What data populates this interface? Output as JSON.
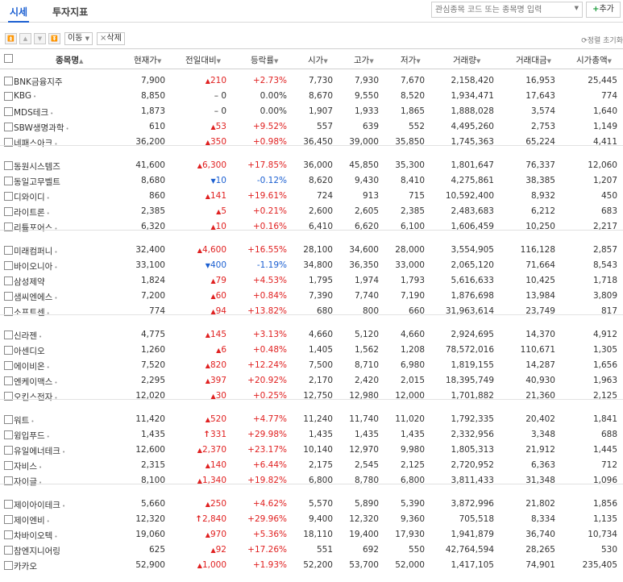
{
  "tabs": [
    {
      "label": "시세",
      "active": true
    },
    {
      "label": "투자지표",
      "active": false
    }
  ],
  "search": {
    "placeholder": "관심종목 코드 또는 종목명 입력",
    "dropdown_icon": "caret-down-icon"
  },
  "add_button": {
    "plus": "+",
    "label": "추가"
  },
  "toolbar": {
    "move_label": "이동",
    "delete_label": "삭제",
    "reset_label": "정렬 초기화"
  },
  "columns": [
    "종목명",
    "현재가",
    "전일대비",
    "등락률",
    "시가",
    "고가",
    "저가",
    "거래량",
    "거래대금",
    "시가총액"
  ],
  "colors": {
    "up": "#e02020",
    "down": "#1b5fd1",
    "accent": "#1b5fd1"
  },
  "groups": [
    [
      {
        "name": "BNK금융지주",
        "dot": false,
        "price": "7,900",
        "change": "210",
        "dir": "up",
        "rate": "+2.73%",
        "open": "7,730",
        "high": "7,930",
        "low": "7,670",
        "volume": "2,158,420",
        "amount": "16,953",
        "cap": "25,445"
      },
      {
        "name": "KBG",
        "dot": true,
        "price": "8,850",
        "change": "0",
        "dir": "flat",
        "rate": "0.00%",
        "open": "8,670",
        "high": "9,550",
        "low": "8,520",
        "volume": "1,934,471",
        "amount": "17,643",
        "cap": "774"
      },
      {
        "name": "MDS테크",
        "dot": true,
        "price": "1,873",
        "change": "0",
        "dir": "flat",
        "rate": "0.00%",
        "open": "1,907",
        "high": "1,933",
        "low": "1,865",
        "volume": "1,888,028",
        "amount": "3,574",
        "cap": "1,640"
      },
      {
        "name": "SBW생명과학",
        "dot": true,
        "price": "610",
        "change": "53",
        "dir": "up",
        "rate": "+9.52%",
        "open": "557",
        "high": "639",
        "low": "552",
        "volume": "4,495,260",
        "amount": "2,753",
        "cap": "1,149"
      },
      {
        "name": "네패스아크",
        "dot": true,
        "price": "36,200",
        "change": "350",
        "dir": "up",
        "rate": "+0.98%",
        "open": "36,450",
        "high": "39,000",
        "low": "35,850",
        "volume": "1,745,363",
        "amount": "65,224",
        "cap": "4,411"
      }
    ],
    [
      {
        "name": "동원시스템즈",
        "dot": false,
        "price": "41,600",
        "change": "6,300",
        "dir": "up",
        "rate": "+17.85%",
        "open": "36,000",
        "high": "45,850",
        "low": "35,300",
        "volume": "1,801,647",
        "amount": "76,337",
        "cap": "12,060"
      },
      {
        "name": "동일고무벨트",
        "dot": false,
        "price": "8,680",
        "change": "10",
        "dir": "down",
        "rate": "-0.12%",
        "open": "8,620",
        "high": "9,430",
        "low": "8,410",
        "volume": "4,275,861",
        "amount": "38,385",
        "cap": "1,207"
      },
      {
        "name": "디와이디",
        "dot": true,
        "price": "860",
        "change": "141",
        "dir": "up",
        "rate": "+19.61%",
        "open": "724",
        "high": "913",
        "low": "715",
        "volume": "10,592,400",
        "amount": "8,932",
        "cap": "450"
      },
      {
        "name": "라이트론",
        "dot": true,
        "price": "2,385",
        "change": "5",
        "dir": "up",
        "rate": "+0.21%",
        "open": "2,600",
        "high": "2,605",
        "low": "2,385",
        "volume": "2,483,683",
        "amount": "6,212",
        "cap": "683"
      },
      {
        "name": "리튬포어스",
        "dot": true,
        "price": "6,320",
        "change": "10",
        "dir": "up",
        "rate": "+0.16%",
        "open": "6,410",
        "high": "6,620",
        "low": "6,100",
        "volume": "1,606,459",
        "amount": "10,250",
        "cap": "2,217"
      }
    ],
    [
      {
        "name": "미래컴퍼니",
        "dot": true,
        "price": "32,400",
        "change": "4,600",
        "dir": "up",
        "rate": "+16.55%",
        "open": "28,100",
        "high": "34,600",
        "low": "28,000",
        "volume": "3,554,905",
        "amount": "116,128",
        "cap": "2,857"
      },
      {
        "name": "바이오니아",
        "dot": true,
        "price": "33,100",
        "change": "400",
        "dir": "down",
        "rate": "-1.19%",
        "open": "34,800",
        "high": "36,350",
        "low": "33,000",
        "volume": "2,065,120",
        "amount": "71,664",
        "cap": "8,543"
      },
      {
        "name": "삼성제약",
        "dot": false,
        "price": "1,824",
        "change": "79",
        "dir": "up",
        "rate": "+4.53%",
        "open": "1,795",
        "high": "1,974",
        "low": "1,793",
        "volume": "5,616,633",
        "amount": "10,425",
        "cap": "1,718"
      },
      {
        "name": "샘씨엔에스",
        "dot": true,
        "price": "7,200",
        "change": "60",
        "dir": "up",
        "rate": "+0.84%",
        "open": "7,390",
        "high": "7,740",
        "low": "7,190",
        "volume": "1,876,698",
        "amount": "13,984",
        "cap": "3,809"
      },
      {
        "name": "소프트센",
        "dot": true,
        "price": "774",
        "change": "94",
        "dir": "up",
        "rate": "+13.82%",
        "open": "680",
        "high": "800",
        "low": "660",
        "volume": "31,963,614",
        "amount": "23,749",
        "cap": "817"
      }
    ],
    [
      {
        "name": "신라젠",
        "dot": true,
        "price": "4,775",
        "change": "145",
        "dir": "up",
        "rate": "+3.13%",
        "open": "4,660",
        "high": "5,120",
        "low": "4,660",
        "volume": "2,924,695",
        "amount": "14,370",
        "cap": "4,912"
      },
      {
        "name": "아센디오",
        "dot": false,
        "price": "1,260",
        "change": "6",
        "dir": "up",
        "rate": "+0.48%",
        "open": "1,405",
        "high": "1,562",
        "low": "1,208",
        "volume": "78,572,016",
        "amount": "110,671",
        "cap": "1,305"
      },
      {
        "name": "에이비온",
        "dot": true,
        "price": "7,520",
        "change": "820",
        "dir": "up",
        "rate": "+12.24%",
        "open": "7,500",
        "high": "8,710",
        "low": "6,980",
        "volume": "1,819,155",
        "amount": "14,287",
        "cap": "1,656"
      },
      {
        "name": "엔케이맥스",
        "dot": true,
        "price": "2,295",
        "change": "397",
        "dir": "up",
        "rate": "+20.92%",
        "open": "2,170",
        "high": "2,420",
        "low": "2,015",
        "volume": "18,395,749",
        "amount": "40,930",
        "cap": "1,963"
      },
      {
        "name": "오킨스전자",
        "dot": true,
        "price": "12,020",
        "change": "30",
        "dir": "up",
        "rate": "+0.25%",
        "open": "12,750",
        "high": "12,980",
        "low": "12,000",
        "volume": "1,701,882",
        "amount": "21,360",
        "cap": "2,125"
      }
    ],
    [
      {
        "name": "워트",
        "dot": true,
        "price": "11,420",
        "change": "520",
        "dir": "up",
        "rate": "+4.77%",
        "open": "11,240",
        "high": "11,740",
        "low": "11,020",
        "volume": "1,792,335",
        "amount": "20,402",
        "cap": "1,841"
      },
      {
        "name": "윙입푸드",
        "dot": true,
        "price": "1,435",
        "change": "331",
        "dir": "limit",
        "rate": "+29.98%",
        "open": "1,435",
        "high": "1,435",
        "low": "1,435",
        "volume": "2,332,956",
        "amount": "3,348",
        "cap": "688"
      },
      {
        "name": "유일에너테크",
        "dot": true,
        "price": "12,600",
        "change": "2,370",
        "dir": "up",
        "rate": "+23.17%",
        "open": "10,140",
        "high": "12,970",
        "low": "9,980",
        "volume": "1,805,313",
        "amount": "21,912",
        "cap": "1,445"
      },
      {
        "name": "자비스",
        "dot": true,
        "price": "2,315",
        "change": "140",
        "dir": "up",
        "rate": "+6.44%",
        "open": "2,175",
        "high": "2,545",
        "low": "2,125",
        "volume": "2,720,952",
        "amount": "6,363",
        "cap": "712"
      },
      {
        "name": "자이글",
        "dot": true,
        "price": "8,100",
        "change": "1,340",
        "dir": "up",
        "rate": "+19.82%",
        "open": "6,800",
        "high": "8,780",
        "low": "6,800",
        "volume": "3,811,433",
        "amount": "31,348",
        "cap": "1,096"
      }
    ],
    [
      {
        "name": "제이아이테크",
        "dot": true,
        "price": "5,660",
        "change": "250",
        "dir": "up",
        "rate": "+4.62%",
        "open": "5,570",
        "high": "5,890",
        "low": "5,390",
        "volume": "3,872,996",
        "amount": "21,802",
        "cap": "1,856"
      },
      {
        "name": "제이엔비",
        "dot": true,
        "price": "12,320",
        "change": "2,840",
        "dir": "limit",
        "rate": "+29.96%",
        "open": "9,400",
        "high": "12,320",
        "low": "9,360",
        "volume": "705,518",
        "amount": "8,334",
        "cap": "1,135"
      },
      {
        "name": "차바이오텍",
        "dot": true,
        "price": "19,060",
        "change": "970",
        "dir": "up",
        "rate": "+5.36%",
        "open": "18,110",
        "high": "19,400",
        "low": "17,930",
        "volume": "1,941,879",
        "amount": "36,740",
        "cap": "10,734"
      },
      {
        "name": "참엔지니어링",
        "dot": false,
        "price": "625",
        "change": "92",
        "dir": "up",
        "rate": "+17.26%",
        "open": "551",
        "high": "692",
        "low": "550",
        "volume": "42,764,594",
        "amount": "28,265",
        "cap": "530"
      },
      {
        "name": "카카오",
        "dot": false,
        "price": "52,900",
        "change": "1,000",
        "dir": "up",
        "rate": "+1.93%",
        "open": "52,200",
        "high": "53,700",
        "low": "52,000",
        "volume": "1,417,105",
        "amount": "74,901",
        "cap": "235,405"
      }
    ]
  ]
}
